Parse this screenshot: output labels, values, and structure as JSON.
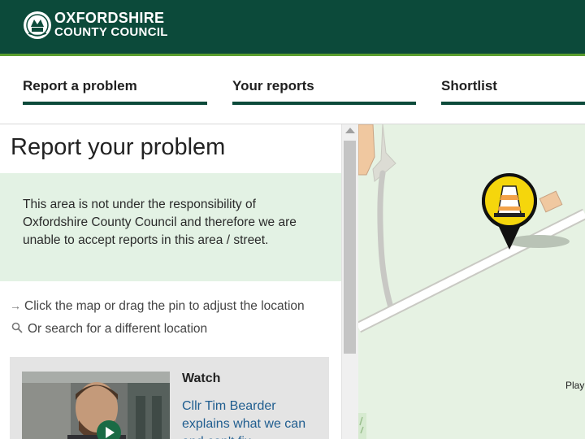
{
  "header": {
    "org_line1": "OXFORDSHIRE",
    "org_line2": "COUNTY COUNCIL"
  },
  "nav": {
    "items": [
      {
        "label": "Report a problem"
      },
      {
        "label": "Your reports"
      },
      {
        "label": "Shortlist"
      }
    ]
  },
  "main": {
    "title": "Report your problem",
    "notice": "This area is not under the responsibility of Oxfordshire County Council and therefore we are unable to accept reports in this area / street.",
    "hints": [
      {
        "icon": "arrow-right-icon",
        "text": "Click the map or drag the pin to adjust the location"
      },
      {
        "icon": "search-icon",
        "text": "Or search for a different location"
      }
    ],
    "video_card": {
      "heading": "Watch",
      "text": "Cllr Tim Bearder explains what we can and can't fix"
    }
  },
  "map": {
    "label": "Play",
    "pin_icon": "roadworks-cone-icon"
  },
  "colors": {
    "header_bg": "#0c4a3a",
    "accent_green": "#5a9e2e",
    "notice_bg": "#e3f2e4",
    "link_blue": "#1f5d8f",
    "pin_yellow": "#f5d60c"
  }
}
